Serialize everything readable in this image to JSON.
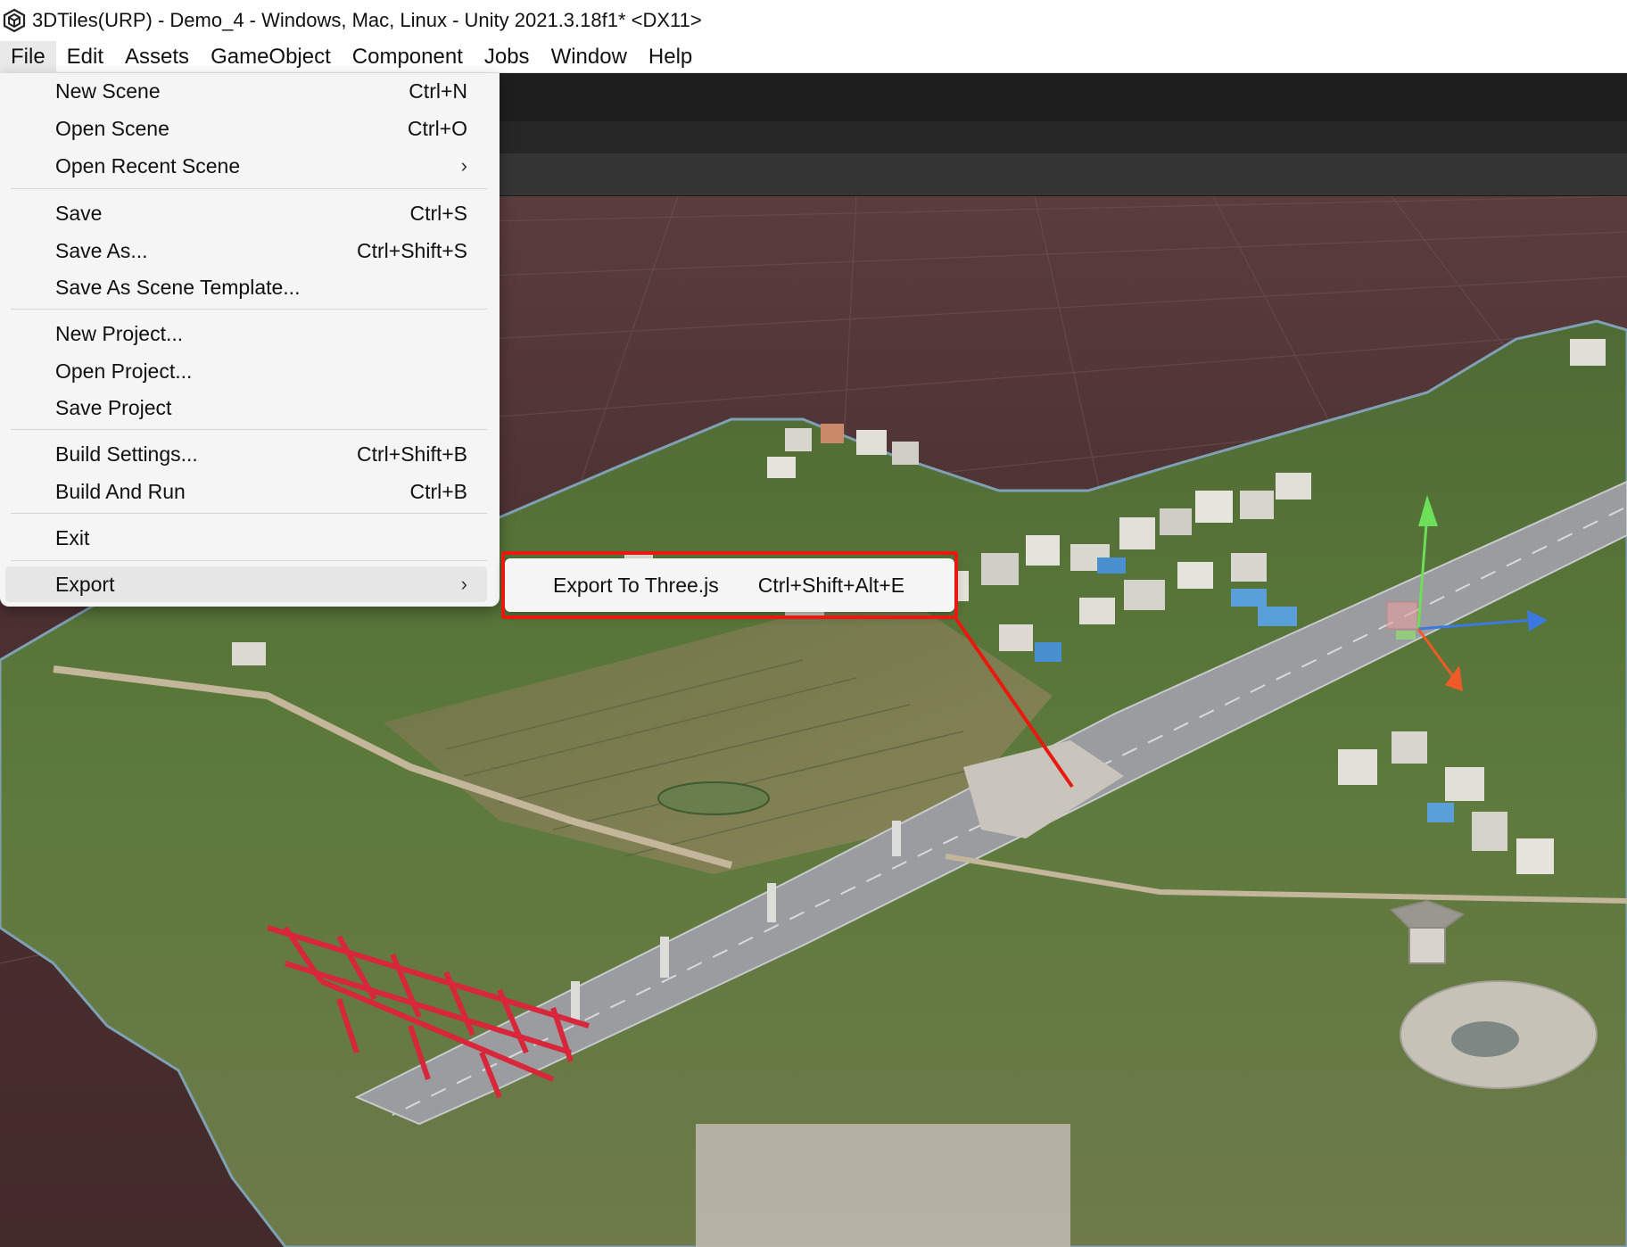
{
  "window": {
    "title": "3DTiles(URP) - Demo_4 - Windows, Mac, Linux - Unity 2021.3.18f1* <DX11>"
  },
  "menubar": {
    "items": [
      "File",
      "Edit",
      "Assets",
      "GameObject",
      "Component",
      "Jobs",
      "Window",
      "Help"
    ],
    "active": "File"
  },
  "file_menu": {
    "new_scene": {
      "label": "New Scene",
      "shortcut": "Ctrl+N"
    },
    "open_scene": {
      "label": "Open Scene",
      "shortcut": "Ctrl+O"
    },
    "open_recent_scene": {
      "label": "Open Recent Scene",
      "arrow": "›"
    },
    "save": {
      "label": "Save",
      "shortcut": "Ctrl+S"
    },
    "save_as": {
      "label": "Save As...",
      "shortcut": "Ctrl+Shift+S"
    },
    "save_as_template": {
      "label": "Save As Scene Template..."
    },
    "new_project": {
      "label": "New Project..."
    },
    "open_project": {
      "label": "Open Project..."
    },
    "save_project": {
      "label": "Save Project"
    },
    "build_settings": {
      "label": "Build Settings...",
      "shortcut": "Ctrl+Shift+B"
    },
    "build_and_run": {
      "label": "Build And Run",
      "shortcut": "Ctrl+B"
    },
    "exit": {
      "label": "Exit"
    },
    "export": {
      "label": "Export",
      "arrow": "›"
    }
  },
  "export_submenu": {
    "export_threejs": {
      "label": "Export To Three.js",
      "shortcut": "Ctrl+Shift+Alt+E"
    }
  },
  "colors": {
    "annotation_red": "#e8190f",
    "menu_bg": "#f5f5f5",
    "grid_floor": "#4d3132"
  },
  "icons": {
    "app": "unity-logo-icon",
    "submenu": "chevron-right-icon",
    "gizmo": "transform-gizmo-icon"
  }
}
